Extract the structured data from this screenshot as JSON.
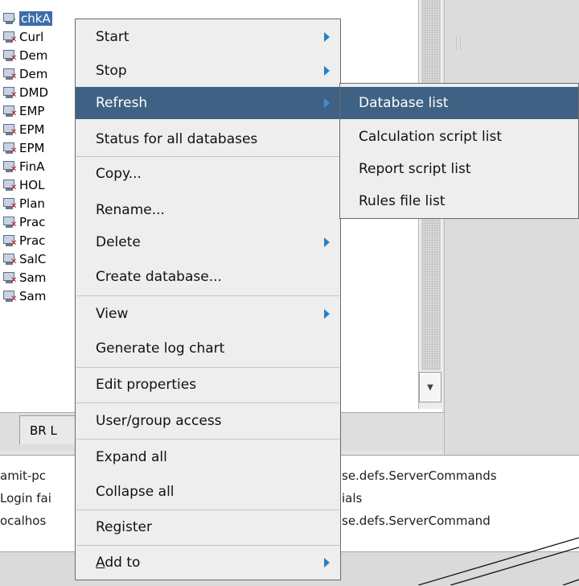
{
  "tree": {
    "items": [
      {
        "label": "chkA",
        "status": "check",
        "selected": true
      },
      {
        "label": "Curl",
        "status": "x"
      },
      {
        "label": "Dem",
        "status": "x"
      },
      {
        "label": "Dem",
        "status": "x"
      },
      {
        "label": "DMD",
        "status": "x"
      },
      {
        "label": "EMP",
        "status": "x"
      },
      {
        "label": "EPM",
        "status": "x"
      },
      {
        "label": "EPM",
        "status": "x"
      },
      {
        "label": "FinA",
        "status": "x"
      },
      {
        "label": "HOL",
        "status": "x"
      },
      {
        "label": "Plan",
        "status": "x"
      },
      {
        "label": "Prac",
        "status": "x"
      },
      {
        "label": "Prac",
        "status": "x"
      },
      {
        "label": "SalC",
        "status": "x"
      },
      {
        "label": "Sam",
        "status": "x"
      },
      {
        "label": "Sam",
        "status": "x"
      }
    ],
    "icon": "database-icon"
  },
  "bottom_tab": {
    "label": "BR L"
  },
  "console": {
    "lines": [
      {
        "left": "amit-pc",
        "right": "se.defs.ServerCommands"
      },
      {
        "left": "Login fai",
        "right": "ials"
      },
      {
        "left": "ocalhos",
        "right": "se.defs.ServerCommand"
      }
    ]
  },
  "context_menu": {
    "items": [
      {
        "label": "Start",
        "submenu": true
      },
      {
        "label": "Stop",
        "submenu": true
      },
      {
        "label": "Refresh",
        "submenu": true,
        "active": true
      },
      {
        "label": "Status for all databases"
      },
      {
        "label": "Copy..."
      },
      {
        "label": "Rename..."
      },
      {
        "label": "Delete",
        "submenu": true
      },
      {
        "label": "Create database..."
      },
      {
        "label": "View",
        "submenu": true
      },
      {
        "label": "Generate log chart"
      },
      {
        "label": "Edit properties"
      },
      {
        "label": "User/group access"
      },
      {
        "label": "Expand all"
      },
      {
        "label": "Collapse all"
      },
      {
        "label": "Register"
      },
      {
        "label_mnemonic": "A",
        "label_rest": "dd to",
        "submenu": true
      }
    ]
  },
  "refresh_submenu": {
    "items": [
      {
        "label": "Database list",
        "active": true
      },
      {
        "label": "Calculation script list"
      },
      {
        "label": "Report script list"
      },
      {
        "label": "Rules file list"
      }
    ]
  },
  "colors": {
    "highlight": "#3f6284",
    "menu_bg": "#eeeeee",
    "arrow": "#2b7fc0",
    "selection": "#3d6ea8"
  }
}
